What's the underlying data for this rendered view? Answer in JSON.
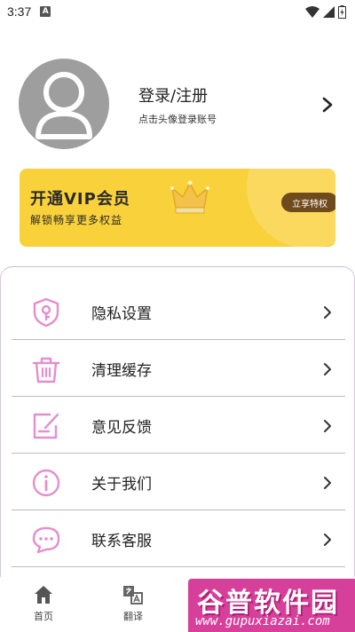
{
  "status_bar": {
    "time": "3:37",
    "notif_glyph": "A"
  },
  "profile": {
    "title": "登录/注册",
    "subtitle": "点击头像登录账号",
    "avatar_icon": "default-avatar-icon"
  },
  "vip": {
    "title": "开通VIP会员",
    "subtitle": "解锁畅享更多权益",
    "button": "立享特权",
    "color": "#f9d13b"
  },
  "menu": [
    {
      "label": "隐私设置",
      "icon": "shield-key-icon"
    },
    {
      "label": "清理缓存",
      "icon": "trash-icon"
    },
    {
      "label": "意见反馈",
      "icon": "edit-note-icon"
    },
    {
      "label": "关于我们",
      "icon": "info-icon"
    },
    {
      "label": "联系客服",
      "icon": "chat-bubble-icon"
    }
  ],
  "nav": [
    {
      "label": "首页",
      "icon": "home-icon"
    },
    {
      "label": "翻译",
      "icon": "translate-icon"
    }
  ],
  "watermark": {
    "title": "谷普软件园",
    "url": "www.gupuxiazai.com"
  },
  "accent_color": "#e99ad6"
}
